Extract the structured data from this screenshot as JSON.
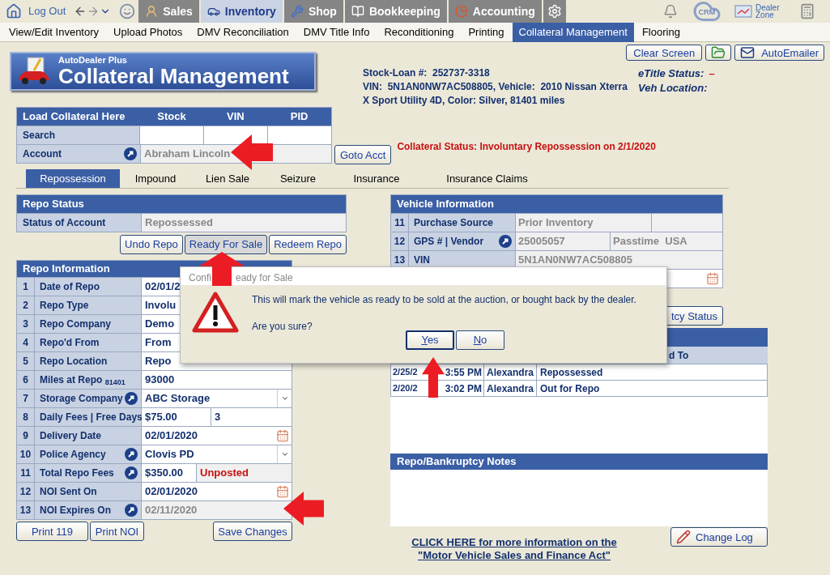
{
  "top_nav": {
    "logout": "Log Out",
    "tabs": [
      {
        "label": "Sales",
        "selected": false
      },
      {
        "label": "Inventory",
        "selected": true
      },
      {
        "label": "Shop",
        "selected": false
      },
      {
        "label": "Bookkeeping",
        "selected": false
      },
      {
        "label": "Accounting",
        "selected": false
      }
    ],
    "crm": "CRM",
    "dealer_zone": "Dealer Zone"
  },
  "sub_nav": [
    {
      "label": "View/Edit Inventory",
      "selected": false
    },
    {
      "label": "Upload Photos",
      "selected": false
    },
    {
      "label": "DMV Reconciliation",
      "selected": false
    },
    {
      "label": "DMV Title Info",
      "selected": false
    },
    {
      "label": "Reconditioning",
      "selected": false
    },
    {
      "label": "Printing",
      "selected": false
    },
    {
      "label": "Collateral Management",
      "selected": true
    },
    {
      "label": "Flooring",
      "selected": false
    }
  ],
  "logo": {
    "brand": "AutoDealer Plus",
    "title": "Collateral Management"
  },
  "vehicle_summary": [
    "Stock-Loan #:  252737-3318",
    "VIN:  5N1AN0NW7AC508805, Vehicle:  2010 Nissan Xterra",
    "X Sport Utility 4D, Color: Silver, 81401 miles"
  ],
  "etitle": {
    "status_label": "eTitle Status:",
    "status_value": "–",
    "location_label": "Veh Location:"
  },
  "header_buttons": {
    "clear": "Clear Screen",
    "emailer": "AutoEmailer"
  },
  "load": {
    "title": "Load Collateral Here",
    "columns": [
      "Stock",
      "VIN",
      "PID"
    ],
    "search_label": "Search",
    "account_label": "Account",
    "account_value": "Abraham Lincoln",
    "goto": "Goto Acct"
  },
  "collateral_status": "Collateral Status: Involuntary Repossession on 2/1/2020",
  "section_tabs": [
    {
      "label": "Repossession",
      "selected": true
    },
    {
      "label": "Impound",
      "selected": false
    },
    {
      "label": "Lien Sale",
      "selected": false
    },
    {
      "label": "Seizure",
      "selected": false
    },
    {
      "label": "Insurance",
      "selected": false
    },
    {
      "label": "Insurance Claims",
      "selected": false
    }
  ],
  "repo_status": {
    "title": "Repo Status",
    "label": "Status of Account",
    "value": "Repossessed",
    "buttons": [
      {
        "label": "Undo Repo",
        "pressed": false
      },
      {
        "label": "Ready For Sale",
        "pressed": true
      },
      {
        "label": "Redeem Repo",
        "pressed": false
      }
    ]
  },
  "repo_info": {
    "title": "Repo Information",
    "rows": [
      {
        "num": "1",
        "label": "Date of Repo",
        "kind": "text",
        "has_link": false,
        "value": "02/01/2"
      },
      {
        "num": "2",
        "label": "Repo Type",
        "kind": "text",
        "has_link": false,
        "value": "Involu"
      },
      {
        "num": "3",
        "label": "Repo Company",
        "kind": "text",
        "has_link": false,
        "value": "Demo"
      },
      {
        "num": "4",
        "label": "Repo'd From",
        "kind": "text",
        "has_link": false,
        "value": "From"
      },
      {
        "num": "5",
        "label": "Repo Location",
        "kind": "text",
        "has_link": false,
        "value": "Repo"
      },
      {
        "num": "6",
        "label": "Miles at Repo $_{81401}$",
        "kind": "text",
        "has_link": false,
        "value": "93000"
      },
      {
        "num": "7",
        "label": "Storage Company",
        "kind": "select",
        "has_link": true,
        "value": "ABC Storage"
      },
      {
        "num": "8",
        "label": "Daily Fees | Free Days",
        "kind": "split",
        "has_link": false,
        "value": "$75.00",
        "value_2": "3"
      },
      {
        "num": "9",
        "label": "Delivery Date",
        "kind": "date",
        "has_link": false,
        "value": "02/01/2020"
      },
      {
        "num": "10",
        "label": "Police Agency",
        "kind": "select",
        "has_link": true,
        "value": "Clovis PD"
      },
      {
        "num": "11",
        "label": "Total Repo Fees",
        "kind": "fee",
        "has_link": true,
        "value": "$350.00",
        "value_2": "Unposted"
      },
      {
        "num": "12",
        "label": "NOI Sent On",
        "kind": "date",
        "has_link": false,
        "value": "02/01/2020"
      },
      {
        "num": "13",
        "label": "NOI Expires On",
        "kind": "readonly",
        "has_link": true,
        "value": "02/11/2020"
      }
    ]
  },
  "repo_buttons": {
    "print_119": "Print 119",
    "print_noi": "Print NOI",
    "save": "Save Changes"
  },
  "vehicle_info": {
    "title": "Vehicle Information",
    "rows": [
      {
        "num": "11",
        "label": "Purchase Source",
        "has_link": false,
        "value": "Prior Inventory"
      },
      {
        "num": "12",
        "label": "GPS # | Vendor",
        "has_link": true,
        "value": "25005057",
        "value_2": "Passtime  USA"
      },
      {
        "num": "13",
        "label": "VIN",
        "has_link": false,
        "value": "5N1AN0NW7AC508805"
      }
    ]
  },
  "bankruptcy_button": "tcy Status",
  "history": {
    "column_4": "d To",
    "rows": [
      {
        "date": "2/25/2",
        "time": "3:55 PM",
        "user": "Alexandra",
        "changed_to": "Repossessed"
      },
      {
        "date": "2/20/2",
        "time": "3:02 PM",
        "user": "Alexandra",
        "changed_to": "Out for Repo"
      }
    ]
  },
  "notes": {
    "title": "Repo/Bankruptcy Notes"
  },
  "info_link": [
    "CLICK HERE for more information on the",
    "\"Motor Vehicle Sales and Finance Act\""
  ],
  "change_log": "Change Log",
  "dialog": {
    "title_parts": [
      "Confi",
      "eady for Sale"
    ],
    "message": "This will mark the vehicle as ready to be sold at the auction, or bought back by the dealer.",
    "question": "Are you sure?",
    "buttons": [
      {
        "label": "Yes",
        "focused": true
      },
      {
        "label": "No",
        "focused": false
      }
    ]
  }
}
